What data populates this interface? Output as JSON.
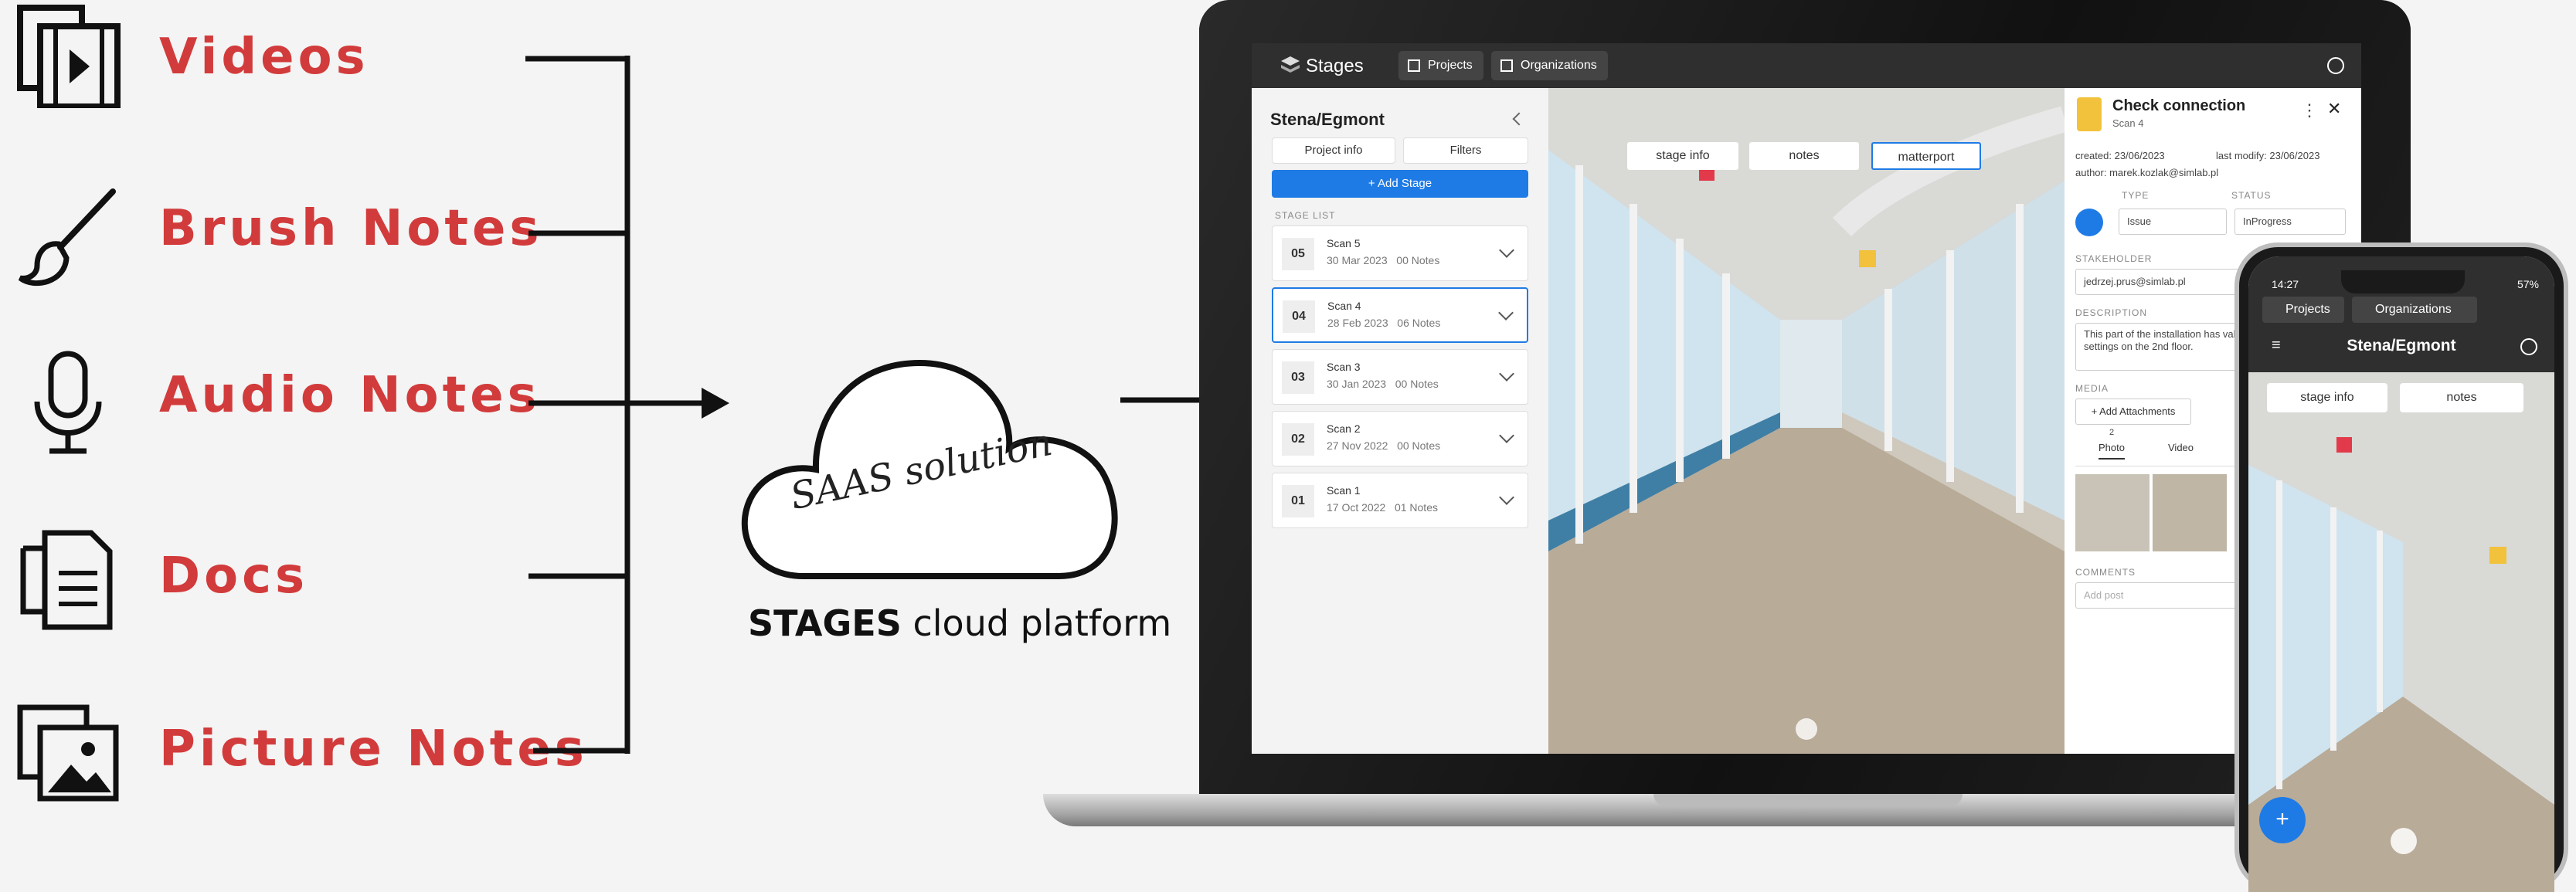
{
  "features": [
    {
      "label": "Videos",
      "icon": "video-file-icon"
    },
    {
      "label": "Brush Notes",
      "icon": "brush-icon"
    },
    {
      "label": "Audio Notes",
      "icon": "microphone-icon"
    },
    {
      "label": "Docs",
      "icon": "documents-icon"
    },
    {
      "label": "Picture Notes",
      "icon": "picture-icon"
    }
  ],
  "cloud": {
    "text": "SAAS solution",
    "caption_bold": "STAGES",
    "caption_rest": " cloud platform"
  },
  "colors": {
    "accent_red": "#d23b3b",
    "primary_blue": "#1e7be6",
    "app_bar": "#2f2f2f"
  },
  "app": {
    "brand": "Stages",
    "nav": {
      "projects": "Projects",
      "organizations": "Organizations"
    },
    "project_title": "Stena/Egmont",
    "project_info": "Project info",
    "filters": "Filters",
    "add_stage": "+ Add Stage",
    "stage_list_label": "STAGE LIST",
    "scans": [
      {
        "num": "05",
        "name": "Scan 5",
        "date": "30 Mar 2023",
        "notes": "00 Notes"
      },
      {
        "num": "04",
        "name": "Scan 4",
        "date": "28 Feb 2023",
        "notes": "06 Notes"
      },
      {
        "num": "03",
        "name": "Scan 3",
        "date": "30 Jan 2023",
        "notes": "00 Notes"
      },
      {
        "num": "02",
        "name": "Scan 2",
        "date": "27 Nov 2022",
        "notes": "00 Notes"
      },
      {
        "num": "01",
        "name": "Scan 1",
        "date": "17 Oct 2022",
        "notes": "01 Notes"
      }
    ],
    "view_tabs": {
      "stage_info": "stage info",
      "notes": "notes",
      "matterport": "matterport"
    },
    "panel": {
      "title": "Check connection",
      "subtitle": "Scan 4",
      "created": "created: 23/06/2023",
      "last_modify": "last modify: 23/06/2023",
      "author": "author: marek.kozlak@simlab.pl",
      "type_label": "TYPE",
      "type_value": "Issue",
      "status_label": "STATUS",
      "status_value": "InProgress",
      "stakeholder_label": "STAKEHOLDER",
      "stakeholder_value": "jedrzej.prus@simlab.pl",
      "description_label": "DESCRIPTION",
      "description_value": "This part of the installation has valves, please check the settings on the 2nd floor.",
      "media_label": "MEDIA",
      "add_attachments": "+ Add Attachments",
      "photo_tab": "Photo",
      "photo_count": "2",
      "video_tab": "Video",
      "comments_label": "COMMENTS",
      "comment_placeholder": "Add post"
    }
  },
  "phone": {
    "time": "14:27",
    "battery": "57%",
    "projects": "Projects",
    "organizations": "Organizations",
    "title": "Stena/Egmont",
    "tab_stage_info": "stage info",
    "tab_notes": "notes"
  }
}
